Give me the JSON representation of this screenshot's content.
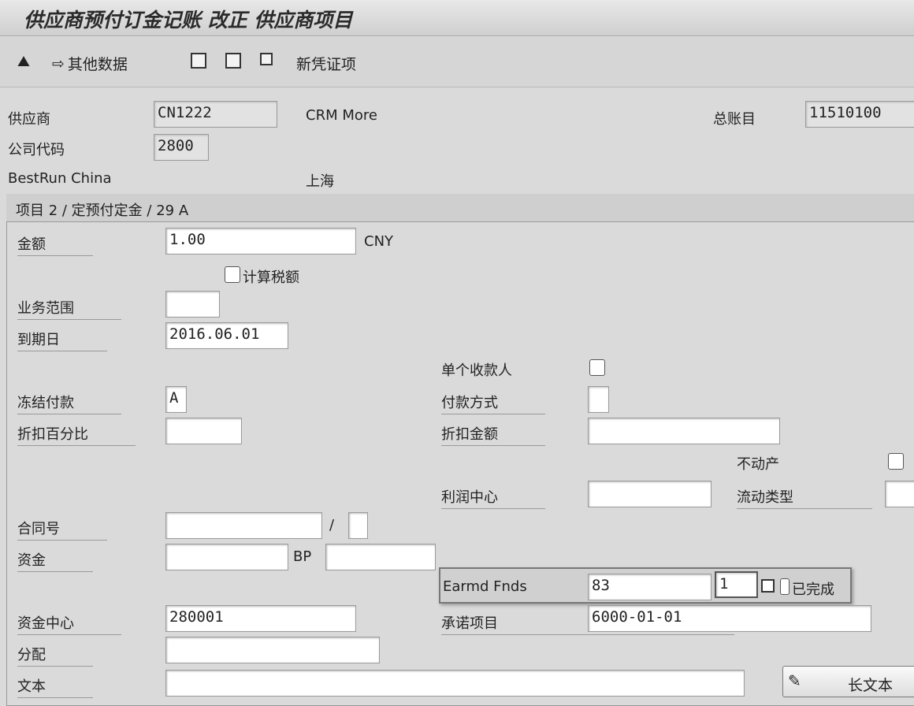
{
  "title": "供应商预付订金记账 改正 供应商项目",
  "toolbar": {
    "other_data": "其他数据",
    "new_item": "新凭证项"
  },
  "header": {
    "vendor_label": "供应商",
    "vendor_value": "CN1222",
    "vendor_name": "CRM More",
    "gl_label": "总账目",
    "gl_value": "11510100",
    "company_label": "公司代码",
    "company_value": "2800",
    "company_name": "BestRun China",
    "city": "上海"
  },
  "group_title": "项目 2 / 定预付定金 / 29 A",
  "form": {
    "amount_label": "金额",
    "amount_value": "1.00",
    "currency": "CNY",
    "calc_tax_label": "计算税额",
    "business_area_label": "业务范围",
    "due_date_label": "到期日",
    "due_date_value": "2016.06.01",
    "single_payee_label": "单个收款人",
    "payment_block_label": "冻结付款",
    "payment_block_value": "A",
    "payment_method_label": "付款方式",
    "discount_pct_label": "折扣百分比",
    "discount_amt_label": "折扣金额",
    "real_estate_label": "不动产",
    "profit_center_label": "利润中心",
    "flow_type_label": "流动类型",
    "contract_label": "合同号",
    "slash": "/",
    "fund_label": "资金",
    "bp_label": "BP",
    "earmd_label": "Earmd Fnds",
    "earmd_value": "83",
    "earmd_item": "1",
    "completed_label": "已完成",
    "fund_center_label": "资金中心",
    "fund_center_value": "280001",
    "commitment_label": "承诺项目",
    "commitment_value": "6000-01-01",
    "assignment_label": "分配",
    "text_label": "文本",
    "long_text_button": "长文本"
  }
}
